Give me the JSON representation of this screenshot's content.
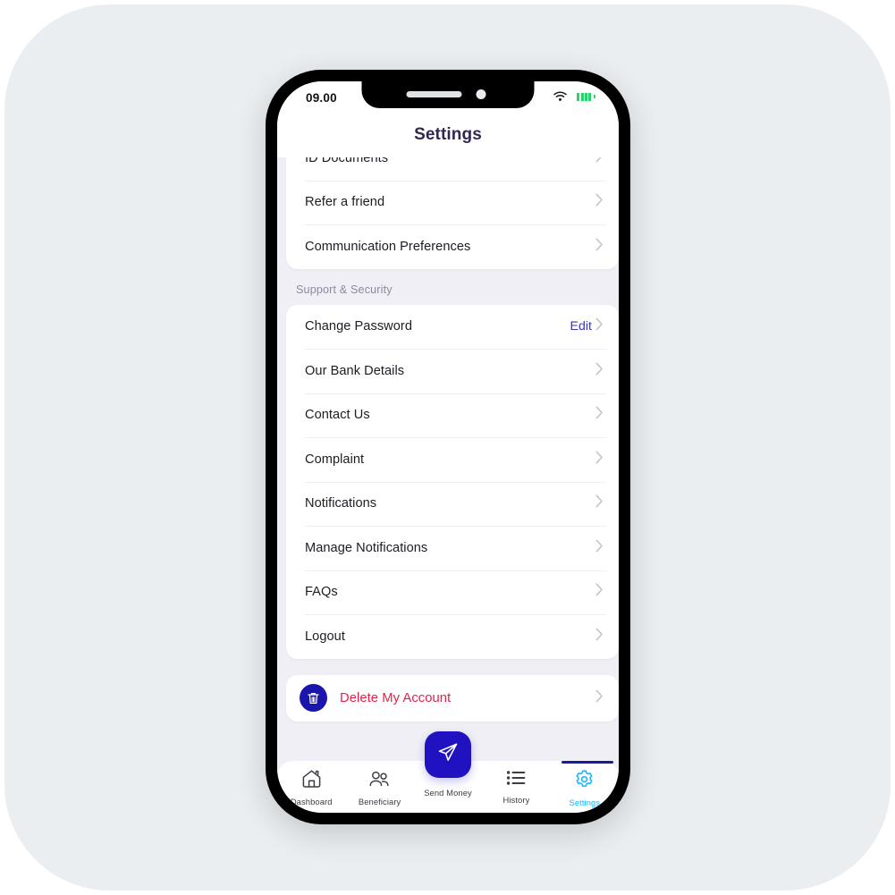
{
  "status_bar": {
    "time": "09.00",
    "wifi_icon": "wifi-icon",
    "battery_icon": "battery-icon",
    "battery_color": "#27d367"
  },
  "header": {
    "title": "Settings",
    "title_color": "#332650"
  },
  "theme": {
    "page_background": "#efeff5",
    "card_background": "#ffffff",
    "accent_blue": "#2012c0",
    "link_blue": "#3a34c8",
    "danger_red": "#e3234a",
    "active_tab": "#18b4f5",
    "outer_background": "#eaeef0"
  },
  "list": {
    "card_top": {
      "rows": [
        {
          "label": "ID Documents",
          "clipped": true,
          "accessory": "chevron-right-icon"
        },
        {
          "label": "Refer a friend",
          "accessory": "chevron-right-icon"
        },
        {
          "label": "Communication Preferences",
          "accessory": "chevron-right-icon"
        }
      ]
    },
    "section_header": "Support & Security",
    "card_support": {
      "rows": [
        {
          "label": "Change Password",
          "value": "Edit",
          "accessory": "chevron-right-icon"
        },
        {
          "label": "Our Bank Details",
          "accessory": "chevron-right-icon"
        },
        {
          "label": "Contact Us",
          "accessory": "chevron-right-icon"
        },
        {
          "label": "Complaint",
          "accessory": "chevron-right-icon"
        },
        {
          "label": "Notifications",
          "accessory": "chevron-right-icon"
        },
        {
          "label": "Manage Notifications",
          "accessory": "chevron-right-icon"
        },
        {
          "label": "FAQs",
          "accessory": "chevron-right-icon"
        },
        {
          "label": "Logout",
          "accessory": "chevron-right-icon"
        }
      ]
    },
    "card_delete": {
      "label": "Delete My Account",
      "icon": "trash-icon",
      "accessory": "chevron-right-icon"
    }
  },
  "tabbar": {
    "items": [
      {
        "label": "Dashboard",
        "icon": "home-icon",
        "active": false
      },
      {
        "label": "Beneficiary",
        "icon": "people-icon",
        "active": false
      },
      {
        "label": "Send Money",
        "icon": "paper-plane-icon",
        "active": false
      },
      {
        "label": "History",
        "icon": "list-icon",
        "active": false
      },
      {
        "label": "Settings",
        "icon": "gear-icon",
        "active": true
      }
    ]
  }
}
